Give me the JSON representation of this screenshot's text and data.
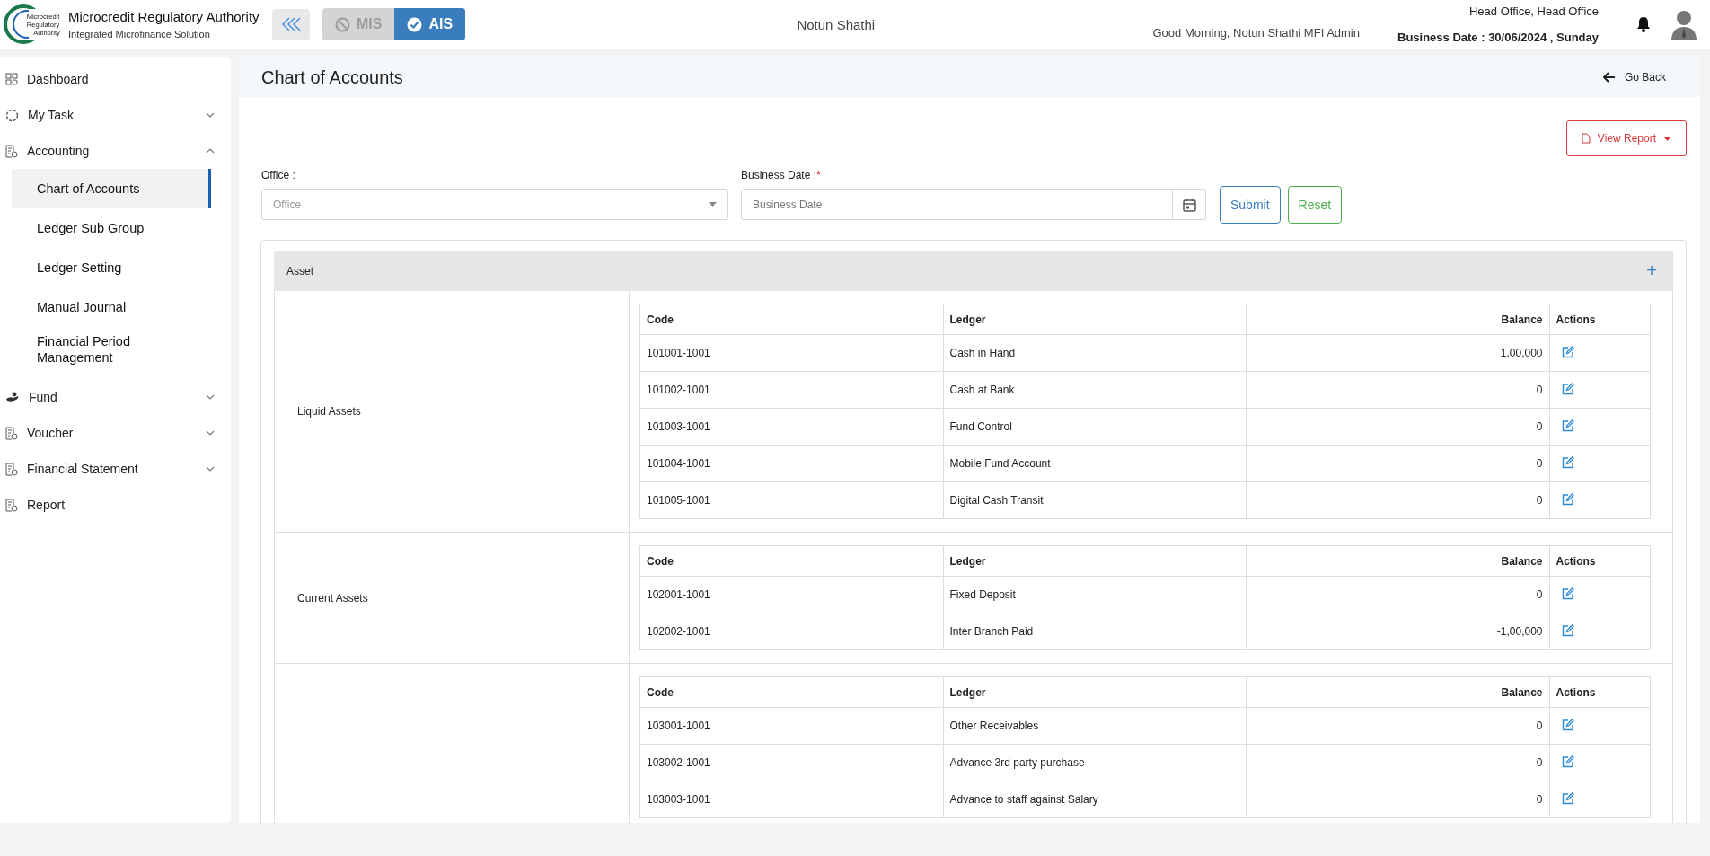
{
  "header": {
    "logo_text": [
      "Microcredit",
      "Regulatory",
      "Authority"
    ],
    "org_name": "Microcredit Regulatory Authority",
    "subtitle": "Integrated Microfinance Solution",
    "modes": [
      {
        "label": "MIS",
        "selected": false
      },
      {
        "label": "AIS",
        "selected": true
      }
    ],
    "center_title": "Notun Shathi",
    "greeting": "Good Morning, Notun Shathi MFI Admin",
    "office": "Head Office, Head Office",
    "business_date": "Business Date : 30/06/2024 , Sunday"
  },
  "sidebar": {
    "items": [
      {
        "label": "Dashboard",
        "kind": "link",
        "selected": false
      },
      {
        "label": "My Task",
        "kind": "group",
        "expanded": false,
        "selected": false
      },
      {
        "label": "Accounting",
        "kind": "group",
        "expanded": true,
        "selected": false,
        "children": [
          {
            "label": "Chart of Accounts",
            "selected": true
          },
          {
            "label": "Ledger Sub Group",
            "selected": false
          },
          {
            "label": "Ledger Setting",
            "selected": false
          },
          {
            "label": "Manual Journal",
            "selected": false
          },
          {
            "label": "Financial Period Management",
            "selected": false
          }
        ]
      },
      {
        "label": "Fund",
        "kind": "group",
        "expanded": false,
        "selected": false
      },
      {
        "label": "Voucher",
        "kind": "group",
        "expanded": false,
        "selected": false
      },
      {
        "label": "Financial Statement",
        "kind": "group",
        "expanded": false,
        "selected": false
      },
      {
        "label": "Report",
        "kind": "link",
        "selected": false
      }
    ]
  },
  "page": {
    "title": "Chart of Accounts",
    "back": "Go Back",
    "view_report": "View Report",
    "filters": {
      "office_label": "Office :",
      "office_placeholder": "Office",
      "date_label": "Business Date :",
      "required_mark": "*",
      "date_placeholder": "Business Date",
      "submit": "Submit",
      "reset": "Reset"
    },
    "section": {
      "title": "Asset",
      "add": "+",
      "groups": [
        {
          "label": "Liquid Assets",
          "columns": [
            "Code",
            "Ledger",
            "Balance",
            "Actions"
          ],
          "rows": [
            {
              "code": "101001-1001",
              "ledger": "Cash in Hand",
              "balance": "1,00,000"
            },
            {
              "code": "101002-1001",
              "ledger": "Cash at Bank",
              "balance": "0"
            },
            {
              "code": "101003-1001",
              "ledger": "Fund Control",
              "balance": "0"
            },
            {
              "code": "101004-1001",
              "ledger": "Mobile Fund Account",
              "balance": "0"
            },
            {
              "code": "101005-1001",
              "ledger": "Digital Cash Transit",
              "balance": "0"
            }
          ]
        },
        {
          "label": "Current Assets",
          "columns": [
            "Code",
            "Ledger",
            "Balance",
            "Actions"
          ],
          "rows": [
            {
              "code": "102001-1001",
              "ledger": "Fixed Deposit",
              "balance": "0"
            },
            {
              "code": "102002-1001",
              "ledger": "Inter Branch Paid",
              "balance": "-1,00,000"
            }
          ]
        },
        {
          "columns": [
            "Code",
            "Ledger",
            "Balance",
            "Actions"
          ],
          "rows": [
            {
              "code": "103001-1001",
              "ledger": "Other Receivables",
              "balance": "0"
            },
            {
              "code": "103002-1001",
              "ledger": "Advance 3rd party purchase",
              "balance": "0"
            },
            {
              "code": "103003-1001",
              "ledger": "Advance to staff against Salary",
              "balance": "0"
            }
          ]
        }
      ]
    }
  }
}
